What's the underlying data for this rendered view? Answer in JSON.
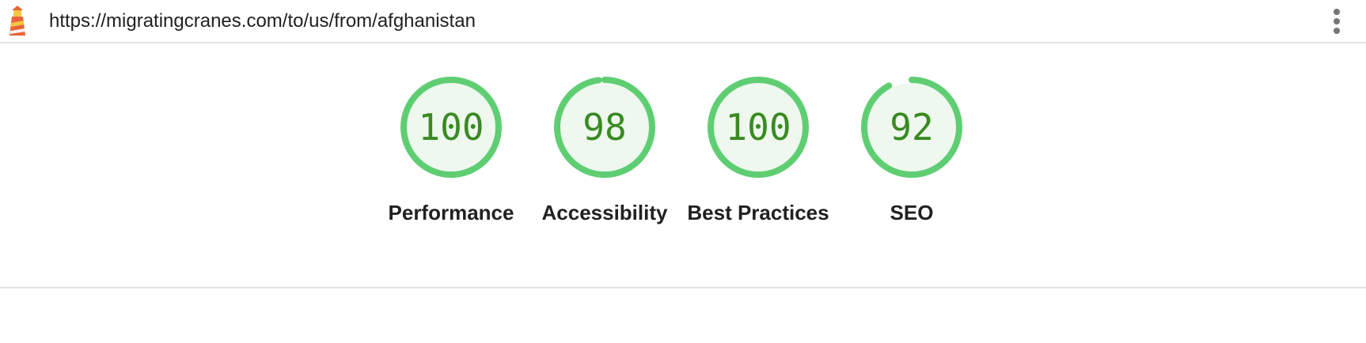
{
  "header": {
    "url": "https://migratingcranes.com/to/us/from/afghanistan",
    "logo_icon": "lighthouse-icon",
    "menu_icon": "more-vert-icon"
  },
  "colors": {
    "pass_ring": "#5fce73",
    "pass_fill": "#eef8ee",
    "pass_text": "#3a8a22",
    "divider": "#e3e3e3"
  },
  "scores": [
    {
      "label": "Performance",
      "value": "100",
      "score": 1.0
    },
    {
      "label": "Accessibility",
      "value": "98",
      "score": 0.98
    },
    {
      "label": "Best Practices",
      "value": "100",
      "score": 1.0
    },
    {
      "label": "SEO",
      "value": "92",
      "score": 0.92
    }
  ]
}
